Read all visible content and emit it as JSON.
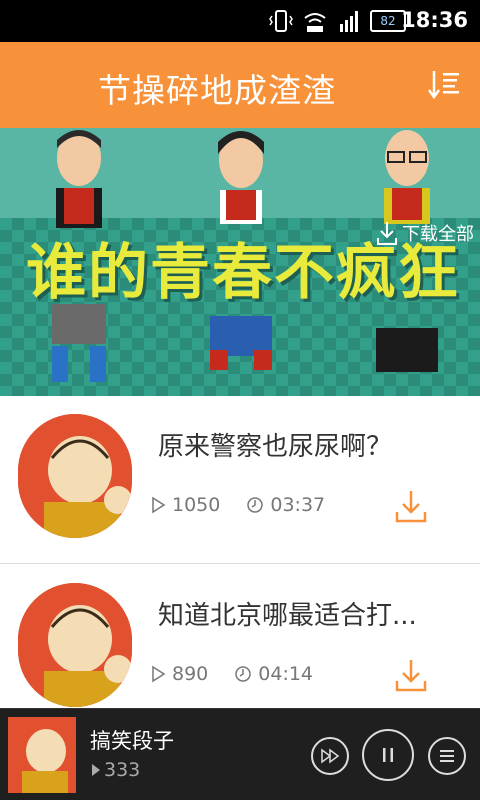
{
  "status_bar": {
    "time": "18:36",
    "battery": "82",
    "icons": [
      "vibrate-icon",
      "wifi-icon",
      "signal-icon",
      "battery-icon"
    ]
  },
  "header": {
    "title": "节操碎地成渣渣",
    "sort_icon": "sort-list-icon",
    "background": "#f7923a"
  },
  "banner": {
    "slogan": "谁的青春不疯狂",
    "download_all_label": "下载全部"
  },
  "list": {
    "items": [
      {
        "title": "原来警察也尿尿啊？",
        "plays": "1050",
        "duration": "03:37"
      },
      {
        "title": "知道北京哪最适合打...",
        "plays": "890",
        "duration": "04:14"
      }
    ]
  },
  "player": {
    "title": "搞笑段子",
    "count": "333"
  },
  "colors": {
    "accent": "#f7923a",
    "player_bg": "#1f1f1f"
  }
}
